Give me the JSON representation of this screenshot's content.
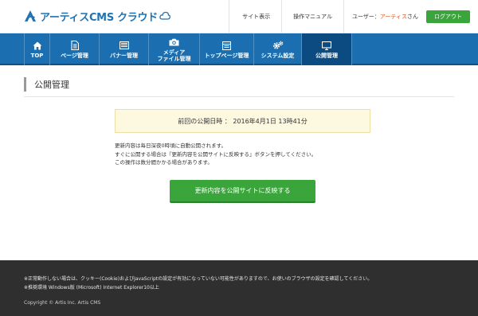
{
  "header": {
    "logo_text": "アーティスCMS クラウド",
    "links": [
      {
        "label": "サイト表示"
      },
      {
        "label": "操作マニュアル"
      }
    ],
    "user": {
      "label": "ユーザー：",
      "name": "アーティス",
      "suffix": "さん"
    },
    "logout_label": "ログアウト"
  },
  "nav": {
    "items": [
      {
        "icon": "home-icon",
        "label": "TOP"
      },
      {
        "icon": "document-icon",
        "label": "ページ管理"
      },
      {
        "icon": "banner-icon",
        "label": "バナー管理"
      },
      {
        "icon": "camera-icon",
        "label_line1": "メディア",
        "label_line2": "ファイル管理"
      },
      {
        "icon": "top-page-icon",
        "label": "トップページ管理"
      },
      {
        "icon": "gears-icon",
        "label": "システム設定"
      },
      {
        "icon": "monitor-icon",
        "label": "公開管理",
        "active": true
      }
    ]
  },
  "main": {
    "page_title": "公開管理",
    "notice": {
      "label": "前回の公開日時 ： ",
      "value": "2016年4月1日 13時41分"
    },
    "description": [
      "更新内容は毎日深夜0時頃に自動公開されます。",
      "すぐに公開する場合は『更新内容を公開サイトに反映する』ボタンを押してください。",
      "この操作は数分間かかる場合があります。"
    ],
    "reflect_button_label": "更新内容を公開サイトに反映する"
  },
  "footer": {
    "notes": [
      "※正常動作しない場合は、クッキー(Cookie)およびJavaScriptの設定が有効になっていない可能性がありますので、お使いのブラウザの設定を確認してください。",
      "※推奨環境 Windows版 (Microsoft) Internet Explorer10以上"
    ],
    "copyright": "Copyright © Artis Inc. Artis CMS"
  },
  "colors": {
    "brand_blue": "#1b6fb0",
    "nav_active": "#0b4b82",
    "button_green": "#3aa53a",
    "user_name_orange": "#e2541b",
    "notice_bg": "#fdf9e1",
    "footer_bg": "#2f2f2f"
  }
}
